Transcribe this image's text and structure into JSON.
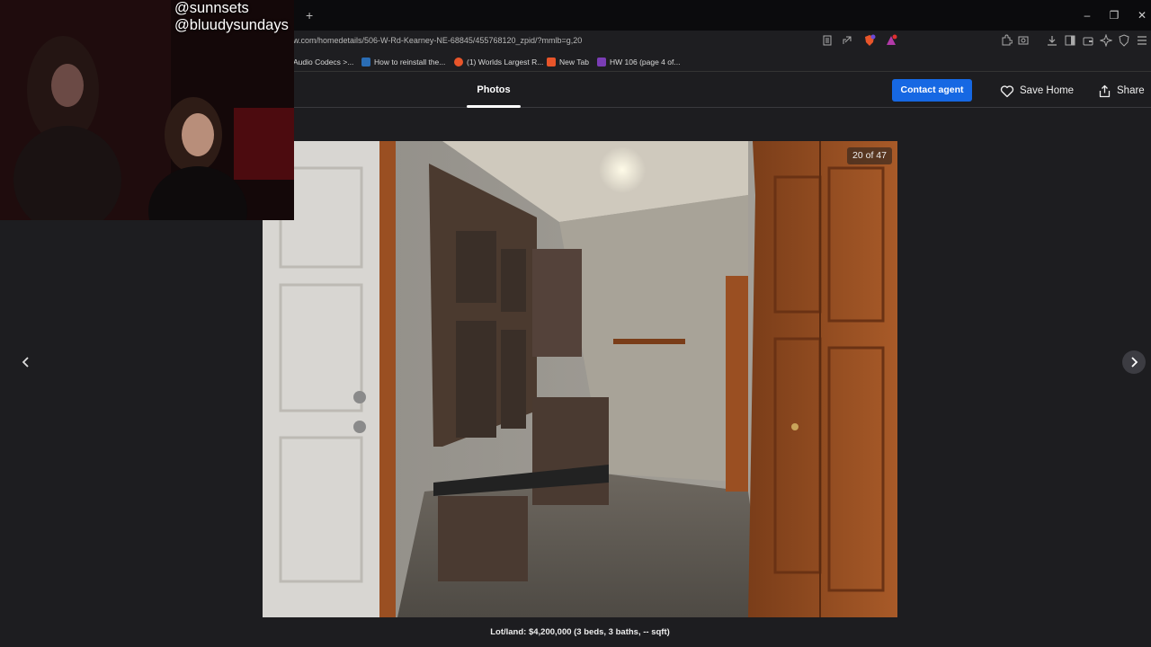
{
  "browser": {
    "new_tab_symbol": "+",
    "url": "w.com/homedetails/506-W-Rd-Kearney-NE-68845/455768120_zpid/?mmlb=g,20",
    "bookmarks": [
      {
        "label": "Audio Codecs >...",
        "icon_color": "#333"
      },
      {
        "label": "How to reinstall the...",
        "icon_color": "#2a6db5"
      },
      {
        "label": "(1) Worlds Largest R...",
        "icon_color": "#e8552a"
      },
      {
        "label": "New Tab",
        "icon_color": "#e8552a"
      },
      {
        "label": "HW 106 (page 4 of...",
        "icon_color": "#7a3db5"
      }
    ],
    "window_controls": {
      "minimize": "–",
      "restore": "❐",
      "close": "✕"
    }
  },
  "header": {
    "tab_photos": "Photos",
    "contact_agent": "Contact agent",
    "save_home": "Save Home",
    "share": "Share"
  },
  "gallery": {
    "counter": "20 of 47",
    "caption": "Lot/land: $4,200,000 (3 beds, 3 baths, -- sqft)"
  },
  "overlay": {
    "handles": "@sunnsets\n@bluudysundays"
  },
  "colors": {
    "accent": "#1668e3",
    "background": "#1d1d20"
  }
}
